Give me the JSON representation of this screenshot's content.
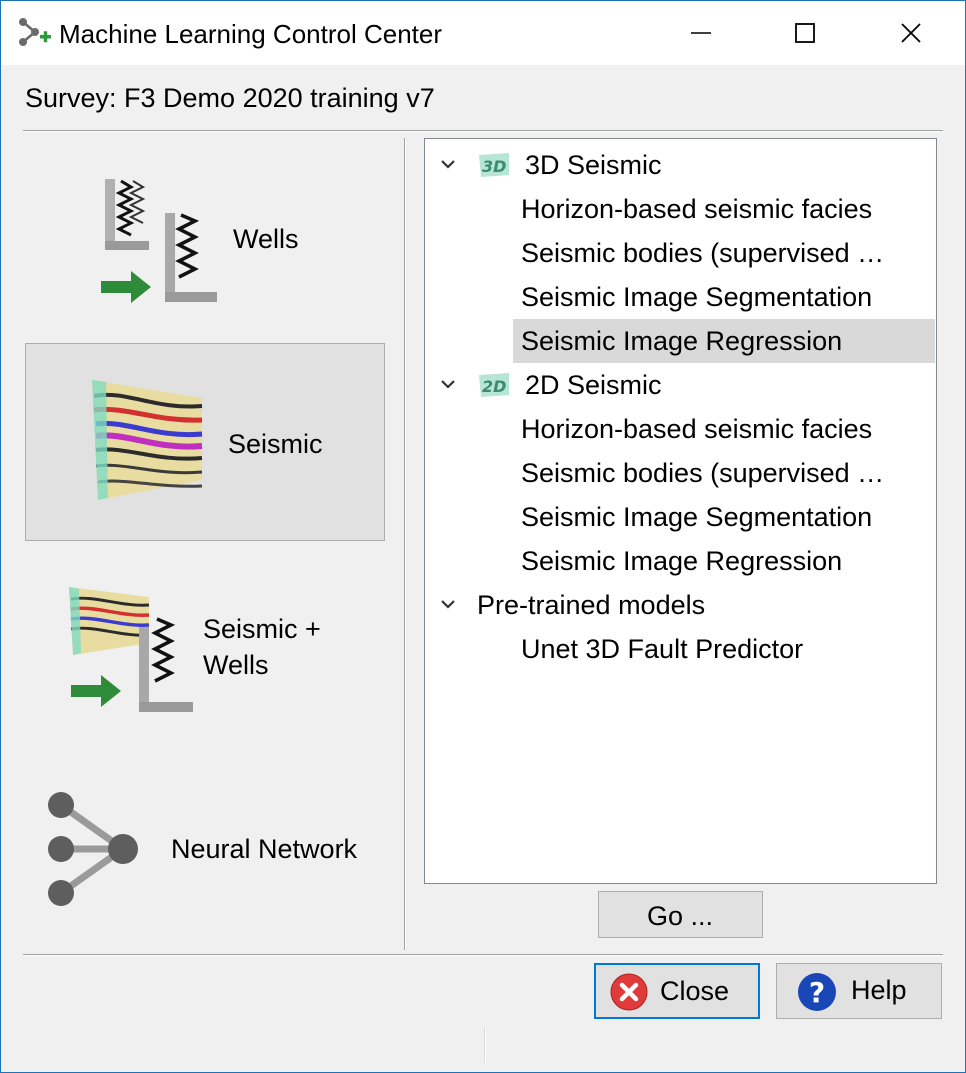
{
  "window": {
    "title": "Machine Learning Control Center",
    "controls": {
      "minimize": "minimize",
      "maximize": "maximize",
      "close": "close"
    }
  },
  "survey_label": "Survey: F3 Demo 2020 training v7",
  "categories": [
    {
      "label": "Wells",
      "icon": "wells-icon",
      "selected": false
    },
    {
      "label": "Seismic",
      "icon": "seismic-icon",
      "selected": true
    },
    {
      "label_line1": "Seismic +",
      "label_line2": "Wells",
      "icon": "seismic-wells-icon",
      "selected": false
    },
    {
      "label": "Neural Network",
      "icon": "neural-network-icon",
      "selected": false
    }
  ],
  "tree": {
    "groups": [
      {
        "label": "3D Seismic",
        "badge": "3D",
        "expanded": true,
        "items": [
          "Horizon-based seismic facies",
          "Seismic bodies (supervised …",
          "Seismic Image Segmentation",
          "Seismic Image Regression"
        ]
      },
      {
        "label": "2D Seismic",
        "badge": "2D",
        "expanded": true,
        "items": [
          "Horizon-based seismic facies",
          "Seismic bodies (supervised …",
          "Seismic Image Segmentation",
          "Seismic Image Regression"
        ]
      },
      {
        "label": "Pre-trained models",
        "expanded": true,
        "items": [
          "Unet 3D Fault Predictor"
        ]
      }
    ],
    "selected_item": "Seismic Image Regression"
  },
  "buttons": {
    "go": "Go ...",
    "close": "Close",
    "help": "Help"
  },
  "colors": {
    "accent": "#0078d7",
    "selection": "#d9d9d9",
    "close_icon": "#e03a3a",
    "help_icon": "#1a47b8",
    "arrow_green": "#2e8b3a"
  }
}
